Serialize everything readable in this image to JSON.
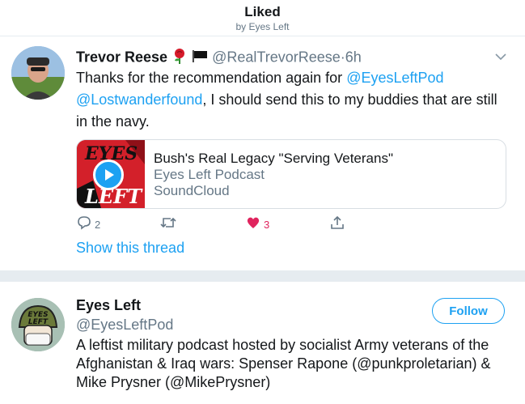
{
  "header": {
    "title": "Liked",
    "subtitle": "by Eyes Left"
  },
  "tweet": {
    "author_name": "Trevor Reese",
    "handle": "@RealTrevorReese",
    "separator": "·",
    "time": "6h",
    "text_before": "Thanks for the recommendation again for ",
    "mention_1": "@EyesLeftPod",
    "mention_2": "@Lostwanderfound",
    "text_after": ", I should send this to my buddies that are still in the navy.",
    "card": {
      "title": "Bush's Real Legacy \"Serving Veterans\"",
      "subtitle": "Eyes Left Podcast",
      "source": "SoundCloud",
      "thumb_text_top": "EYES",
      "thumb_text_bottom": "LEFT"
    },
    "actions": {
      "reply_count": "2",
      "retweet_count": "",
      "like_count": "3"
    },
    "show_thread": "Show this thread"
  },
  "profile": {
    "name": "Eyes Left",
    "handle": "@EyesLeftPod",
    "follow_label": "Follow",
    "bio": "A leftist military podcast hosted by socialist Army veterans of the Afghanistan & Iraq wars: Spenser Rapone (@punkproletarian) & Mike Prysner (@MikePrysner)",
    "avatar_text_top": "EYES",
    "avatar_text_bottom": "LEFT"
  },
  "colors": {
    "accent": "#1da1f2",
    "like": "#e0245e",
    "muted": "#657786",
    "separator": "#e6ecf0"
  }
}
